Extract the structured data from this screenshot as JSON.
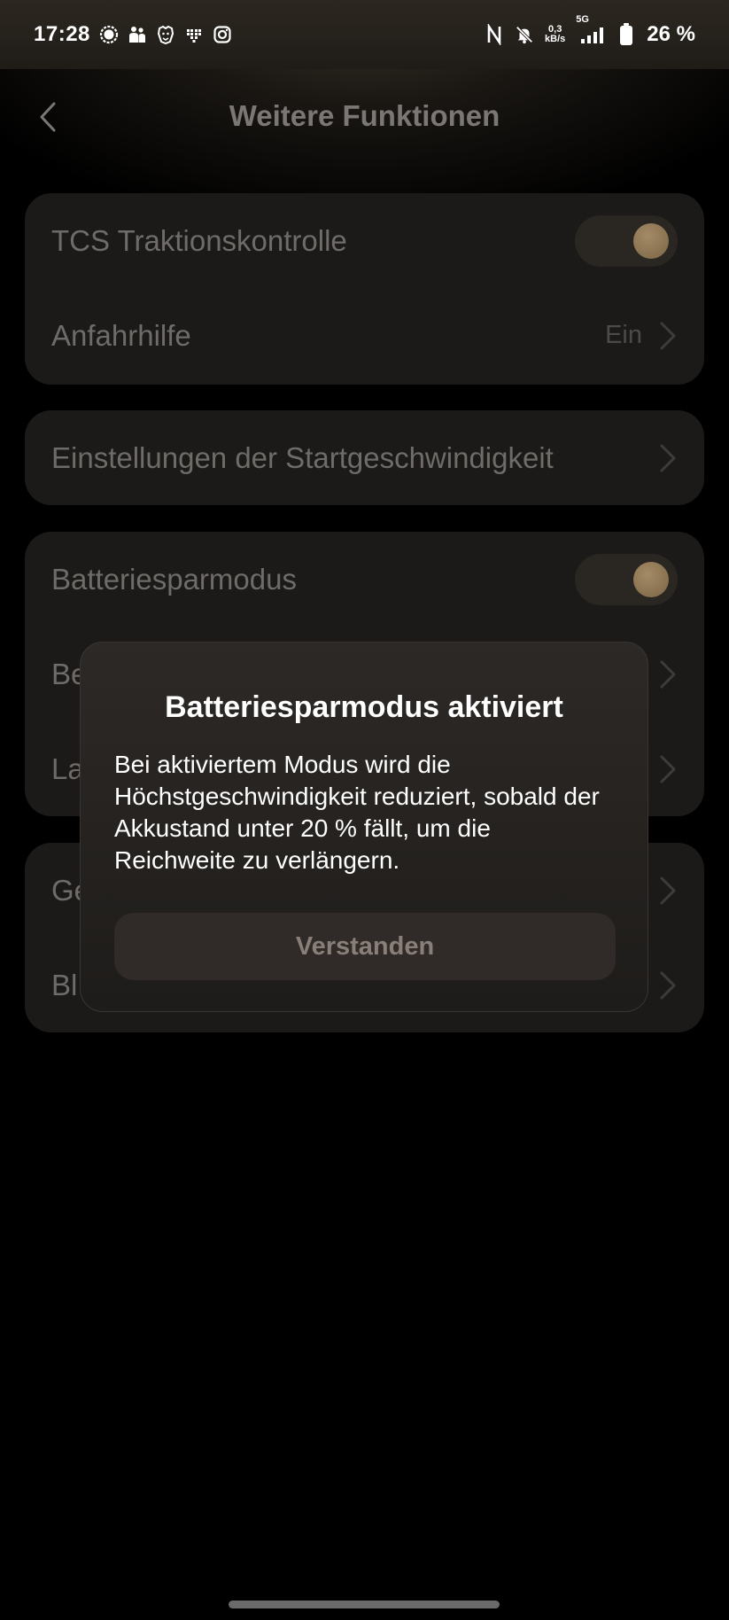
{
  "status_bar": {
    "time": "17:28",
    "net_speed_value": "0,3",
    "net_speed_unit": "kB/s",
    "network_type": "5G",
    "battery_percent": "26 %",
    "icons": [
      "signal-messenger-icon",
      "people-icon",
      "lion-app-icon",
      "heart-pixel-icon",
      "instagram-icon",
      "nfc-icon",
      "bell-muted-icon",
      "cell-signal-icon",
      "battery-icon"
    ]
  },
  "header": {
    "title": "Weitere Funktionen",
    "back_icon": "chevron-left-icon"
  },
  "card1": {
    "rows": [
      {
        "label": "TCS Traktionskontrolle",
        "toggle_on": true
      },
      {
        "label": "Anfahrhilfe",
        "value": "Ein"
      }
    ]
  },
  "card2": {
    "rows": [
      {
        "label": "Einstellungen der Startgeschwindigkeit"
      }
    ]
  },
  "card3": {
    "rows": [
      {
        "label": "Batteriesparmodus",
        "toggle_on": true
      },
      {
        "label": "Be"
      },
      {
        "label": "La"
      }
    ]
  },
  "card4": {
    "rows": [
      {
        "label": "Ge"
      },
      {
        "label": "Bl"
      }
    ]
  },
  "dialog": {
    "title": "Batteriesparmodus aktiviert",
    "body": "Bei aktiviertem Modus wird die Höchstgeschwindigkeit reduziert, sobald der Akkustand unter 20 % fällt, um die Reichweite zu verlängern.",
    "button_label": "Verstanden"
  },
  "colors": {
    "background": "#000000",
    "card": "#1b1a18",
    "accent_knob": "#a48a66",
    "dialog_bg": "#2d2926"
  }
}
